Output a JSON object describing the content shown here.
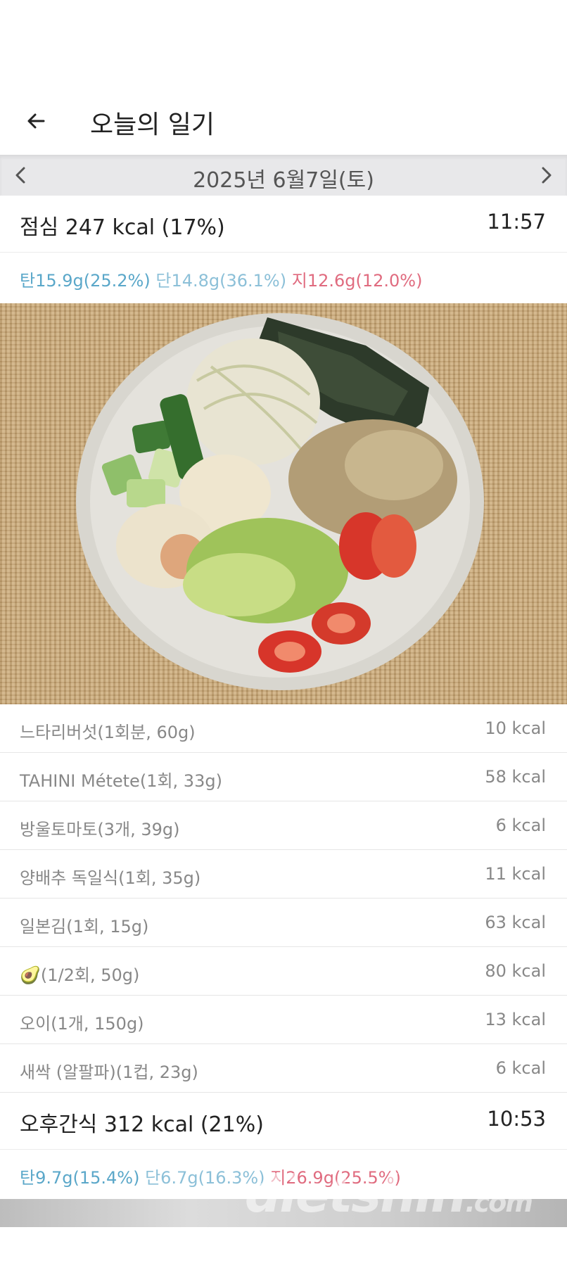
{
  "header": {
    "title": "오늘의 일기",
    "back_icon": "arrow-left-icon"
  },
  "date_nav": {
    "label": "2025년 6월7일(토)",
    "prev_icon": "chevron-left-icon",
    "next_icon": "chevron-right-icon"
  },
  "meals": [
    {
      "title": "점심 247 kcal (17%)",
      "time": "11:57",
      "macros": {
        "carb": "탄15.9g(25.2%)",
        "protein": "단14.8g(36.1%)",
        "fat": "지12.6g(12.0%)"
      },
      "items": [
        {
          "name": "느타리버섯(1회분, 60g)",
          "kcal": "10 kcal"
        },
        {
          "name": "TAHINI Métete(1회, 33g)",
          "kcal": "58 kcal"
        },
        {
          "name": "방울토마토(3개, 39g)",
          "kcal": "6 kcal"
        },
        {
          "name": "양배추 독일식(1회, 35g)",
          "kcal": "11 kcal"
        },
        {
          "name": "일본김(1회, 15g)",
          "kcal": "63 kcal"
        },
        {
          "name": "🥑(1/2회, 50g)",
          "kcal": "80 kcal"
        },
        {
          "name": "오이(1개, 150g)",
          "kcal": "13 kcal"
        },
        {
          "name": "새싹 (알팔파)(1컵, 23g)",
          "kcal": "6 kcal"
        }
      ]
    },
    {
      "title": "오후간식 312 kcal (21%)",
      "time": "10:53",
      "macros": {
        "carb": "탄9.7g(15.4%)",
        "protein": "단6.7g(16.3%)",
        "fat": "지26.9g(25.5%)"
      }
    }
  ],
  "watermark": {
    "main": "dietshin",
    "suffix": ".com"
  },
  "colors": {
    "carb": "#5aa7c9",
    "protein": "#8cc0d8",
    "fat": "#e06b7f",
    "date_bar": "#e8e8ea"
  }
}
